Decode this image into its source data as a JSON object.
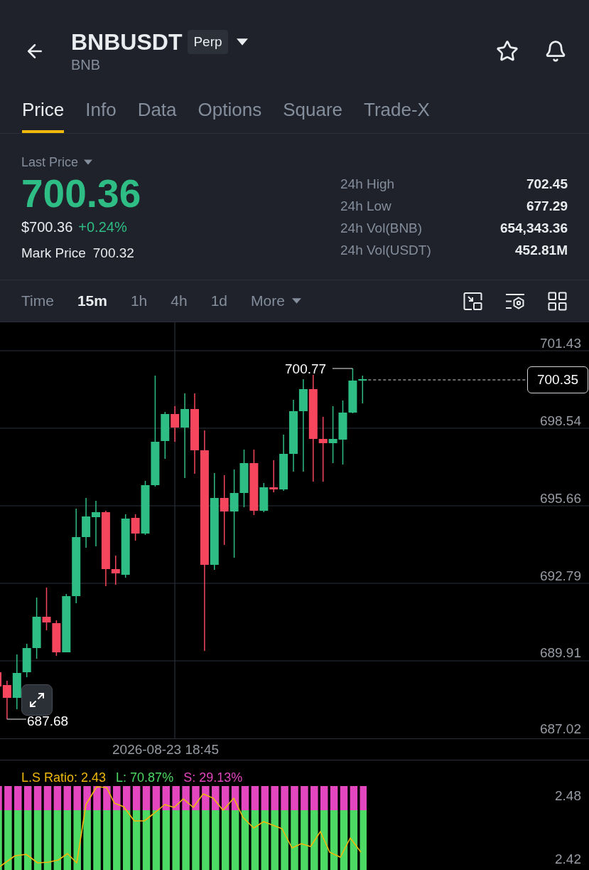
{
  "header": {
    "symbol": "BNBUSDT",
    "badge": "Perp",
    "base": "BNB"
  },
  "tabs": [
    {
      "label": "Price",
      "selected": true
    },
    {
      "label": "Info",
      "selected": false
    },
    {
      "label": "Data",
      "selected": false
    },
    {
      "label": "Options",
      "selected": false
    },
    {
      "label": "Square",
      "selected": false
    },
    {
      "label": "Trade-X",
      "selected": false
    }
  ],
  "ticker": {
    "last_price_label": "Last Price",
    "last_price": "700.36",
    "rising": true,
    "usd_price": "$700.36",
    "change": "+0.24%",
    "mark_price_label": "Mark Price",
    "mark_price": "700.32",
    "stats": [
      {
        "label": "24h High",
        "value": "702.45"
      },
      {
        "label": "24h Low",
        "value": "677.29"
      },
      {
        "label": "24h Vol(BNB)",
        "value": "654,343.36"
      },
      {
        "label": "24h Vol(USDT)",
        "value": "452.81M"
      }
    ]
  },
  "intervals": [
    {
      "label": "Time",
      "kind": "option",
      "selected": false
    },
    {
      "label": "15m",
      "kind": "option",
      "selected": true
    },
    {
      "label": "1h",
      "kind": "option",
      "selected": false
    },
    {
      "label": "4h",
      "kind": "option",
      "selected": false
    },
    {
      "label": "1d",
      "kind": "option",
      "selected": false
    },
    {
      "label": "More",
      "kind": "menu",
      "selected": false
    }
  ],
  "chart": {
    "price_axis": [
      "701.43",
      "698.54",
      "695.66",
      "692.79",
      "689.91",
      "687.02"
    ],
    "high_marker": "700.77",
    "low_marker": "687.68",
    "current_price": "700.35",
    "crosshair_time": "2026-08-23 18:45"
  },
  "indicator": {
    "legend": [
      {
        "text": "L.S Ratio: 2.43",
        "color": "#f0b90b"
      },
      {
        "text": "L: 70.87%",
        "color": "#4cd964"
      },
      {
        "text": "S: 29.13%",
        "color": "#e446bf"
      }
    ],
    "axis": [
      "2.48",
      "2.42"
    ]
  }
}
